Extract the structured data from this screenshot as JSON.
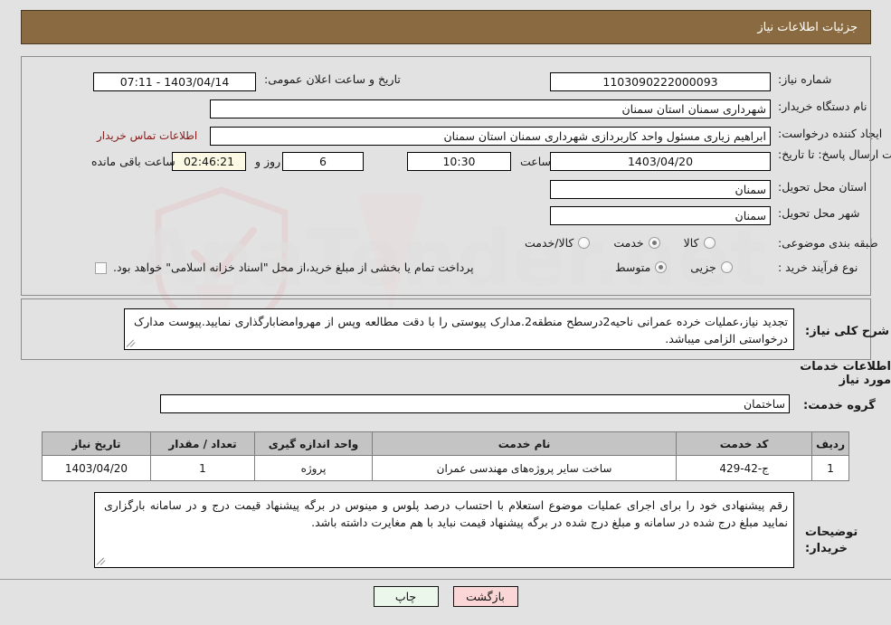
{
  "header": {
    "title": "جزئیات اطلاعات نیاز"
  },
  "form": {
    "need_number_label": "شماره نیاز:",
    "need_number_value": "1103090222000093",
    "public_announce_label": "تاریخ و ساعت اعلان عمومی:",
    "public_announce_value": "1403/04/14 - 07:11",
    "buyer_org_label": "نام دستگاه خریدار:",
    "buyer_org_value": "شهرداری سمنان استان سمنان",
    "requester_label": "ایجاد کننده درخواست:",
    "requester_value": "ابراهیم زیاری مسئول واحد کاربردازی شهرداری سمنان استان سمنان",
    "contact_link": "اطلاعات تماس خریدار",
    "deadline_label": "مهلت ارسال پاسخ: تا تاریخ:",
    "deadline_date": "1403/04/20",
    "hour_label": "ساعت",
    "deadline_time": "10:30",
    "days_remaining": "6",
    "days_and_label": "روز و",
    "time_remaining": "02:46:21",
    "remaining_suffix_label": "ساعت باقی مانده",
    "province_label": "استان محل تحویل:",
    "province_value": "سمنان",
    "city_label": "شهر محل تحویل:",
    "city_value": "سمنان",
    "category_label": "طبقه بندی موضوعی:",
    "category_options": [
      {
        "label": "کالا",
        "selected": false
      },
      {
        "label": "خدمت",
        "selected": true
      },
      {
        "label": "کالا/خدمت",
        "selected": false
      }
    ],
    "process_label": "نوع فرآیند خرید :",
    "process_options": [
      {
        "label": "جزیی",
        "selected": false
      },
      {
        "label": "متوسط",
        "selected": true
      }
    ],
    "treasury_checkbox_label": "پرداخت تمام یا بخشی از مبلغ خرید،از محل \"اسناد خزانه اسلامی\" خواهد بود.",
    "treasury_checked": false
  },
  "description": {
    "label": "شرح کلی نیاز:",
    "value": "تجدید نیاز،عملیات خرده عمرانی ناحیه2درسطح منطقه2.مدارک پیوستی را با دقت مطالعه وپس از مهروامضابارگذاری نمایید.پیوست مدارک درخواستی الزامی میباشد."
  },
  "services": {
    "section_title": "اطلاعات خدمات مورد نیاز",
    "group_label": "گروه خدمت:",
    "group_value": "ساختمان",
    "columns": [
      "ردیف",
      "کد خدمت",
      "نام خدمت",
      "واحد اندازه گیری",
      "تعداد / مقدار",
      "تاریخ نیاز"
    ],
    "rows": [
      {
        "index": "1",
        "code": "ج-42-429",
        "name": "ساخت سایر پروژه‌های مهندسی عمران",
        "unit": "پروژه",
        "quantity": "1",
        "need_date": "1403/04/20"
      }
    ]
  },
  "buyer_notes": {
    "label": "توضیحات خریدار:",
    "value": "رقم پیشنهادی خود را برای اجرای عملیات موضوع استعلام با احتساب درصد پلوس و مینوس در برگه پیشنهاد قیمت درج و در سامانه بارگزاری نمایید مبلغ درج شده در سامانه و مبلغ درج شده در برگه پیشنهاد قیمت نباید با هم مغایرت داشته باشد."
  },
  "footer": {
    "print_label": "چاپ",
    "back_label": "بازگشت"
  },
  "watermark": {
    "text": "AnaTender.net"
  },
  "colors": {
    "header_bg": "#8a6b41",
    "accent_link": "#8b1a1a",
    "page_bg": "#e2e2e2",
    "table_header_bg": "#c4c4c4",
    "print_btn_bg": "#eaf7ea",
    "back_btn_bg": "#fbd6d6",
    "highlight_field_bg": "#fbf8e3"
  }
}
